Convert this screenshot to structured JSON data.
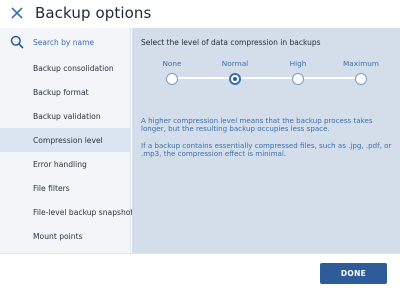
{
  "header": {
    "title": "Backup options"
  },
  "sidebar": {
    "search_label": "Search by name",
    "items": [
      {
        "label": "Backup consolidation",
        "active": false
      },
      {
        "label": "Backup format",
        "active": false
      },
      {
        "label": "Backup validation",
        "active": false
      },
      {
        "label": "Compression level",
        "active": true
      },
      {
        "label": "Error handling",
        "active": false
      },
      {
        "label": "File filters",
        "active": false
      },
      {
        "label": "File-level backup snapshot",
        "active": false
      },
      {
        "label": "Mount points",
        "active": false
      }
    ]
  },
  "main": {
    "heading": "Select the level of data compression in backups",
    "levels": [
      "None",
      "Normal",
      "High",
      "Maximum"
    ],
    "selected_level": "Normal",
    "info_1": "A higher compression level means that the backup process takes longer, but the resulting backup occupies less space.",
    "info_2": "If a backup contains essentially compressed files, such as .jpg, .pdf, or .mp3, the compression effect is minimal."
  },
  "footer": {
    "done_label": "DONE"
  },
  "colors": {
    "accent": "#2e5c9a",
    "panel": "#d4deeb",
    "sidebar": "#f3f5f8",
    "active_item": "#dbe5f1",
    "link": "#3a6fb0"
  }
}
